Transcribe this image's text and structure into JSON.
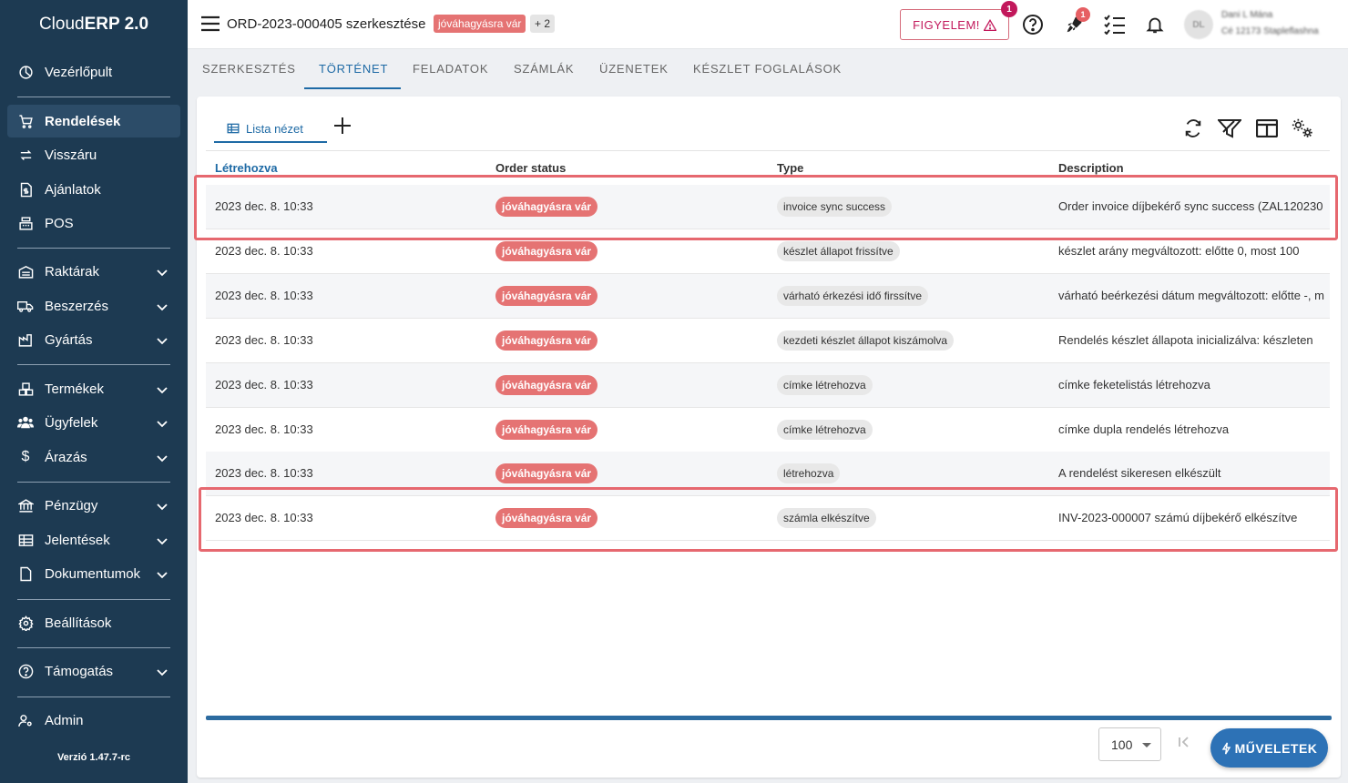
{
  "app": {
    "name_light": "Cloud",
    "name_bold": "ERP 2.0",
    "version": "Verzió 1.47.7-rc"
  },
  "sidebar": {
    "items": [
      {
        "label": "Vezérlőpult",
        "icon": "dashboard-icon"
      },
      {
        "label": "Rendelések",
        "icon": "cart-icon",
        "active": true
      },
      {
        "label": "Visszáru",
        "icon": "swap-icon"
      },
      {
        "label": "Ajánlatok",
        "icon": "dollar-document-icon"
      },
      {
        "label": "POS",
        "icon": "cash-register-icon"
      },
      {
        "label": "Raktárak",
        "icon": "warehouse-icon",
        "expandable": true
      },
      {
        "label": "Beszerzés",
        "icon": "truck-icon",
        "expandable": true
      },
      {
        "label": "Gyártás",
        "icon": "factory-icon",
        "expandable": true
      },
      {
        "label": "Termékek",
        "icon": "boxes-icon",
        "expandable": true
      },
      {
        "label": "Ügyfelek",
        "icon": "users-icon",
        "expandable": true
      },
      {
        "label": "Árazás",
        "icon": "dollar-icon",
        "expandable": true
      },
      {
        "label": "Pénzügy",
        "icon": "bank-icon",
        "expandable": true
      },
      {
        "label": "Jelentések",
        "icon": "table-icon",
        "expandable": true
      },
      {
        "label": "Dokumentumok",
        "icon": "document-icon",
        "expandable": true
      },
      {
        "label": "Beállítások",
        "icon": "gear-icon"
      },
      {
        "label": "Támogatás",
        "icon": "help-icon",
        "expandable": true
      },
      {
        "label": "Admin",
        "icon": "admin-icon"
      }
    ]
  },
  "header": {
    "title": "ORD-2023-000405 szerkesztése",
    "status": "jóváhagyásra vár",
    "extra": "+ 2",
    "warning_label": "FIGYELEM!",
    "warning_count": "1",
    "rocket_count": "1",
    "user": {
      "initials": "DL",
      "name": "Dani L Mána",
      "company": "Cé 12173 Stapleflashna"
    }
  },
  "tabs": [
    {
      "label": "SZERKESZTÉS"
    },
    {
      "label": "TÖRTÉNET",
      "active": true
    },
    {
      "label": "FELADATOK"
    },
    {
      "label": "SZÁMLÁK"
    },
    {
      "label": "ÜZENETEK"
    },
    {
      "label": "KÉSZLET FOGLALÁSOK"
    }
  ],
  "view": {
    "tab_label": "Lista nézet"
  },
  "table": {
    "columns": [
      "Létrehozva",
      "Order status",
      "Type",
      "Description"
    ],
    "rows": [
      {
        "created": "2023 dec. 8. 10:33",
        "status": "jóváhagyásra vár",
        "type": "invoice sync success",
        "description": "Order invoice díjbekérő sync success (ZAL120230"
      },
      {
        "created": "2023 dec. 8. 10:33",
        "status": "jóváhagyásra vár",
        "type": "készlet állapot frissítve",
        "description": "készlet arány megváltozott: előtte 0, most 100"
      },
      {
        "created": "2023 dec. 8. 10:33",
        "status": "jóváhagyásra vár",
        "type": "várható érkezési idő firssítve",
        "description": "várható beérkezési dátum megváltozott: előtte -, m"
      },
      {
        "created": "2023 dec. 8. 10:33",
        "status": "jóváhagyásra vár",
        "type": "kezdeti készlet állapot kiszámolva",
        "description": "Rendelés készlet állapota inicializálva: készleten"
      },
      {
        "created": "2023 dec. 8. 10:33",
        "status": "jóváhagyásra vár",
        "type": "címke létrehozva",
        "description": "címke feketelistás létrehozva"
      },
      {
        "created": "2023 dec. 8. 10:33",
        "status": "jóváhagyásra vár",
        "type": "címke létrehozva",
        "description": "címke dupla rendelés létrehozva"
      },
      {
        "created": "2023 dec. 8. 10:33",
        "status": "jóváhagyásra vár",
        "type": "létrehozva",
        "description": "A rendelést sikeresen elkészült"
      },
      {
        "created": "2023 dec. 8. 10:33",
        "status": "jóváhagyásra vár",
        "type": "számla elkészítve",
        "description": "INV-2023-000007 számú díjbekérő elkészítve"
      }
    ]
  },
  "pagination": {
    "page_size": "100"
  },
  "actions": {
    "label": "MŰVELETEK"
  },
  "colors": {
    "sidebar": "#1d3a52",
    "accent": "#1e6aa5",
    "status_red": "#e57373",
    "highlight": "#e6686f"
  }
}
